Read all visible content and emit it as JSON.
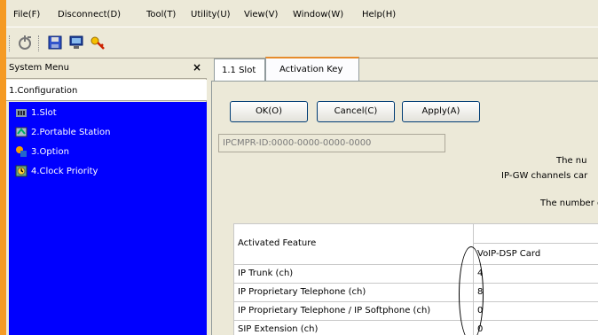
{
  "menubar": {
    "items": [
      "File(F)",
      "Disconnect(D)",
      "Tool(T)",
      "Utility(U)",
      "View(V)",
      "Window(W)",
      "Help(H)"
    ]
  },
  "toolbar": {
    "icons": [
      "connect-icon",
      "save-icon",
      "monitor-icon",
      "key-icon"
    ]
  },
  "left_panel": {
    "title": "System Menu",
    "close_label": "×",
    "section": "1.Configuration",
    "items": [
      "1.Slot",
      "2.Portable Station",
      "3.Option",
      "4.Clock Priority"
    ]
  },
  "tabs": [
    {
      "label": "1.1 Slot",
      "active": false
    },
    {
      "label": "Activation Key",
      "active": true
    }
  ],
  "buttons": {
    "ok": "OK(O)",
    "cancel": "Cancel(C)",
    "apply": "Apply(A)"
  },
  "id_field": {
    "value": "IPCMPR-ID:0000-0000-0000-0000"
  },
  "info": {
    "line1": "The nu",
    "line2": "IP-GW channels car",
    "line3": "The number c"
  },
  "table": {
    "header_feature": "Activated Feature",
    "header_card": "VoIP-DSP Card",
    "rows": [
      {
        "feature": "IP Trunk (ch)",
        "value": "4"
      },
      {
        "feature": "IP Proprietary Telephone (ch)",
        "value": "8"
      },
      {
        "feature": "IP Proprietary Telephone / IP Softphone (ch)",
        "value": "0"
      },
      {
        "feature": "SIP Extension (ch)",
        "value": "0"
      }
    ]
  },
  "colors": {
    "tree_bg": "#0000ff",
    "side_accent": "#f59a23",
    "tab_accent": "#e68b2c"
  }
}
